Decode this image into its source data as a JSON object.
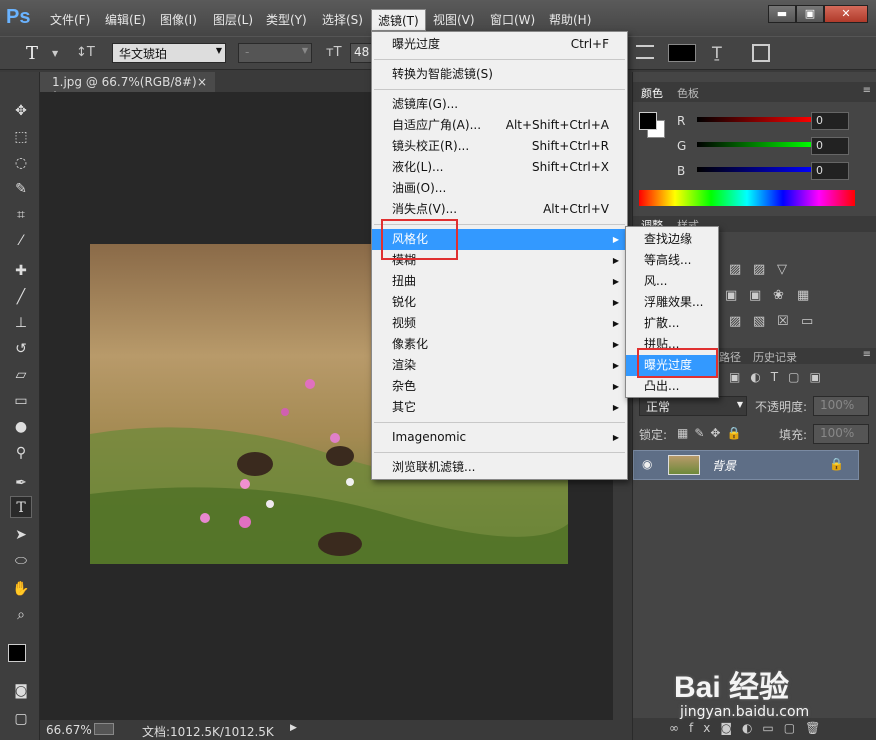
{
  "app": {
    "logo": "Ps"
  },
  "menubar": {
    "items": [
      "文件(F)",
      "编辑(E)",
      "图像(I)",
      "图层(L)",
      "类型(Y)",
      "选择(S)",
      "滤镜(T)",
      "视图(V)",
      "窗口(W)",
      "帮助(H)"
    ],
    "minimize": "▬",
    "maximize": "▣",
    "close": "✕"
  },
  "options": {
    "tool_glyph": "T",
    "orient_glyph": "↕T",
    "font_family": "华文琥珀",
    "font_style": "-",
    "size_prefix": "48"
  },
  "document": {
    "tab_title": "1.jpg @ 66.7%(RGB/8#) *",
    "tab_close": "×",
    "zoom": "66.67%",
    "doc_info": "文档:1012.5K/1012.5K"
  },
  "filter_menu": {
    "items": [
      {
        "label": "曝光过度",
        "shortcut": "Ctrl+F"
      },
      {
        "sep": true
      },
      {
        "label": "转换为智能滤镜(S)"
      },
      {
        "sep": true
      },
      {
        "label": "滤镜库(G)..."
      },
      {
        "label": "自适应广角(A)...",
        "shortcut": "Alt+Shift+Ctrl+A"
      },
      {
        "label": "镜头校正(R)...",
        "shortcut": "Shift+Ctrl+R"
      },
      {
        "label": "液化(L)...",
        "shortcut": "Shift+Ctrl+X"
      },
      {
        "label": "油画(O)..."
      },
      {
        "label": "消失点(V)...",
        "shortcut": "Alt+Ctrl+V"
      },
      {
        "sep": true
      },
      {
        "label": "风格化",
        "submenu": true,
        "highlighted": true
      },
      {
        "label": "模糊",
        "submenu": true
      },
      {
        "label": "扭曲",
        "submenu": true
      },
      {
        "label": "锐化",
        "submenu": true
      },
      {
        "label": "视频",
        "submenu": true
      },
      {
        "label": "像素化",
        "submenu": true
      },
      {
        "label": "渲染",
        "submenu": true
      },
      {
        "label": "杂色",
        "submenu": true
      },
      {
        "label": "其它",
        "submenu": true
      },
      {
        "sep": true
      },
      {
        "label": "Imagenomic",
        "submenu": true
      },
      {
        "sep": true
      },
      {
        "label": "浏览联机滤镜..."
      }
    ]
  },
  "stylize_submenu": {
    "items": [
      "查找边缘",
      "等高线...",
      "风...",
      "浮雕效果...",
      "扩散...",
      "拼贴...",
      "曝光过度",
      "凸出..."
    ],
    "highlighted_index": 6
  },
  "color_panel": {
    "tabs": [
      "颜色",
      "色板"
    ],
    "channels": [
      {
        "label": "R",
        "value": "0",
        "color": "#ff0000"
      },
      {
        "label": "G",
        "value": "0",
        "color": "#00ff00"
      },
      {
        "label": "B",
        "value": "0",
        "color": "#0000ff"
      }
    ]
  },
  "adjust_panel": {
    "tabs": [
      "调整",
      "样式"
    ]
  },
  "layers_panel": {
    "tabs": [
      "路径",
      "历史记录"
    ],
    "blend_mode": "正常",
    "opacity_label": "不透明度:",
    "opacity_value": "100%",
    "lock_label": "锁定:",
    "fill_label": "填充:",
    "fill_value": "100%",
    "layer_name": "背景"
  },
  "watermark": {
    "text": "Bai 经验",
    "url": "jingyan.baidu.com"
  },
  "colors": {
    "highlight": "#3399ff",
    "annotation": "#e03030"
  }
}
